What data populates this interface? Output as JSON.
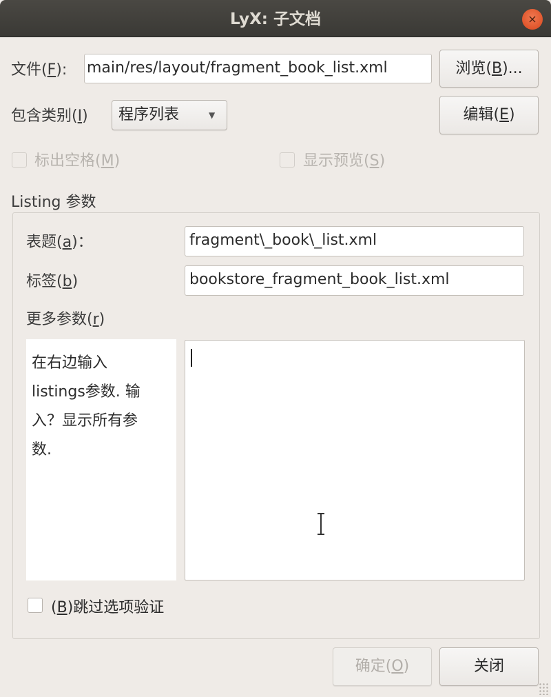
{
  "window": {
    "title": "LyX: 子文档",
    "close_glyph": "×"
  },
  "file": {
    "label_pre": "文件(",
    "label_key": "F",
    "label_post": "):",
    "value": "main/res/layout/fragment_book_list.xml"
  },
  "browse": {
    "pre": "浏览(",
    "key": "B",
    "post": ")..."
  },
  "include_type": {
    "label_pre": "包含类别(",
    "label_key": "I",
    "label_post": ")",
    "selected": "程序列表"
  },
  "edit": {
    "pre": "编辑(",
    "key": "E",
    "post": ")"
  },
  "mark_spaces": {
    "pre": "标出空格(",
    "key": "M",
    "post": ")"
  },
  "show_preview": {
    "pre": "显示预览(",
    "key": "S",
    "post": ")"
  },
  "listing": {
    "group_title": "Listing 参数",
    "caption": {
      "pre": "表题(",
      "key": "a",
      "post": ")：",
      "value": "fragment\\_book\\_list.xml"
    },
    "label": {
      "pre": "标签(",
      "key": "b",
      "post": ")",
      "value": "bookstore_fragment_book_list.xml"
    },
    "more": {
      "pre": "更多参数(",
      "key": "r",
      "post": ")"
    },
    "help_lines": [
      "在右边输入",
      "listings参数. 输",
      "入？显示所有参",
      "数."
    ],
    "more_value": "",
    "bypass": {
      "pre": "(",
      "key": "B",
      "post": ")跳过选项验证"
    }
  },
  "buttons": {
    "ok": {
      "pre": "确定(",
      "key": "O",
      "post": ")"
    },
    "close": "关闭"
  }
}
